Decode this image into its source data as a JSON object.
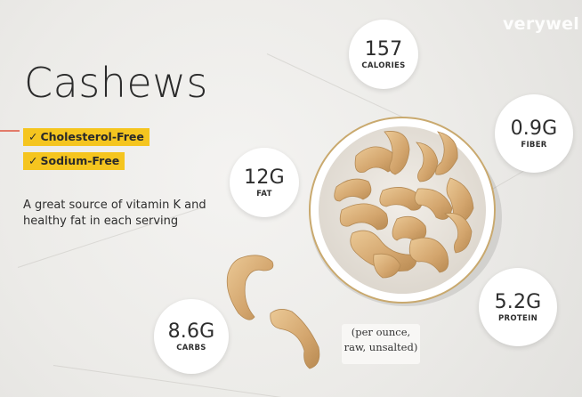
{
  "brand": "verywel",
  "title": "Cashews",
  "badges": {
    "cholesterol": "Cholesterol-Free",
    "sodium": "Sodium-Free",
    "check_icon": "✓"
  },
  "tagline": "A great source of vitamin K and healthy fat in each serving",
  "nutrients": {
    "calories": {
      "value": "157",
      "label": "CALORIES"
    },
    "fiber": {
      "value": "0.9G",
      "label": "FIBER"
    },
    "fat": {
      "value": "12G",
      "label": "FAT"
    },
    "protein": {
      "value": "5.2G",
      "label": "PROTEIN"
    },
    "carbs": {
      "value": "8.6G",
      "label": "CARBS"
    }
  },
  "note": {
    "line1": "(per ounce,",
    "line2": "raw, unsalted)"
  },
  "colors": {
    "badge": "#f5c51f",
    "cashew": "#d9b07a",
    "bowl_rim": "#c9a96e"
  }
}
